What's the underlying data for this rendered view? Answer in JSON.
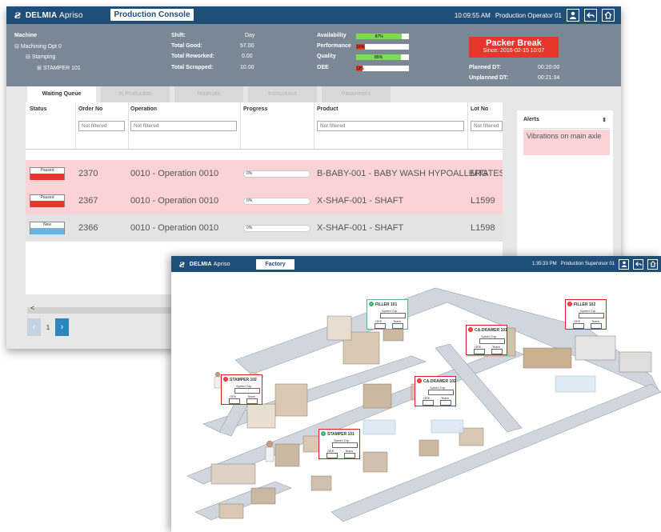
{
  "console": {
    "brand": {
      "bold": "DELMIA",
      "light": "Apriso"
    },
    "title_button": "Production Console",
    "time": "10:09:55 AM",
    "user": "Production Operator 01",
    "machine_tree": {
      "header": "Machine",
      "items": [
        "Machining Opt 0",
        "Stamping",
        "STAMPER 101"
      ]
    },
    "shift_info": {
      "shift_label": "Shift:",
      "shift_value": "Day",
      "good_label": "Total Good:",
      "good_value": "57.00",
      "reworked_label": "Total Reworked:",
      "reworked_value": "0.00",
      "scrapped_label": "Total Scrapped:",
      "scrapped_value": "10.00"
    },
    "kpis": [
      {
        "label": "Availability",
        "value": "87%",
        "fraction": 0.87,
        "color": "#7ed957"
      },
      {
        "label": "Performance",
        "value": "16%",
        "fraction": 0.16,
        "color": "#e8362c"
      },
      {
        "label": "Quality",
        "value": "85%",
        "fraction": 0.85,
        "color": "#7ed957"
      },
      {
        "label": "OEE",
        "value": "12%",
        "fraction": 0.12,
        "color": "#e8362c"
      }
    ],
    "alarm": {
      "title": "Packer Break",
      "since": "Since: 2016-02-15 10:07"
    },
    "downtime": {
      "planned_label": "Planned DT:",
      "planned_value": "00:20:00",
      "unplanned_label": "Unplanned DT:",
      "unplanned_value": "00:21:34"
    },
    "tabs": [
      "Waiting Queue",
      "In Production",
      "Materials",
      "Instructions",
      "Parameters"
    ],
    "active_tab": 0,
    "grid": {
      "columns": [
        "Status",
        "Order No",
        "Operation",
        "Progress",
        "Product",
        "Lot No"
      ],
      "filter_placeholder": "Not filtered",
      "rows": [
        {
          "status": "Paused",
          "status_color": "#e8362c",
          "order": "2370",
          "operation": "0010 - Operation 0010",
          "progress": "0%",
          "product": "B-BABY-001 - BABY WASH HYPOALLERG",
          "lot": "MTATEST"
        },
        {
          "status": "Paused",
          "status_color": "#e8362c",
          "order": "2367",
          "operation": "0010 - Operation 0010",
          "progress": "0%",
          "product": "X-SHAF-001 - SHAFT",
          "lot": "L1599"
        },
        {
          "status": "New",
          "status_color": "#6fb3d6",
          "order": "2366",
          "operation": "0010 - Operation 0010",
          "progress": "0%",
          "product": "X-SHAF-001 - SHAFT",
          "lot": "L1598"
        }
      ]
    },
    "alerts": {
      "header": "Alerts",
      "items": [
        "Vibrations on main axle"
      ]
    },
    "pager": {
      "prev": "‹",
      "page": "1",
      "next": "›",
      "scroll_left": "<"
    }
  },
  "factory": {
    "brand": {
      "bold": "DELMIA",
      "light": "Apriso"
    },
    "title_button": "Factory",
    "time": "1:35:33 PM",
    "user": "Production Supervisor 01",
    "tiles": [
      {
        "title": "FILLER 101",
        "status": "ok"
      },
      {
        "title": "FILLER 102",
        "status": "alarm"
      },
      {
        "title": "CA-DRAWER 101",
        "status": "alarm"
      },
      {
        "title": "CA-DRAWER 102",
        "status": "alarm"
      },
      {
        "title": "STAMPER 102",
        "status": "alarm"
      },
      {
        "title": "STAMPER 101",
        "status": "ok"
      }
    ],
    "tile_labels": {
      "speed": "Speed Grp",
      "oee": "OEE",
      "team": "Team"
    }
  }
}
